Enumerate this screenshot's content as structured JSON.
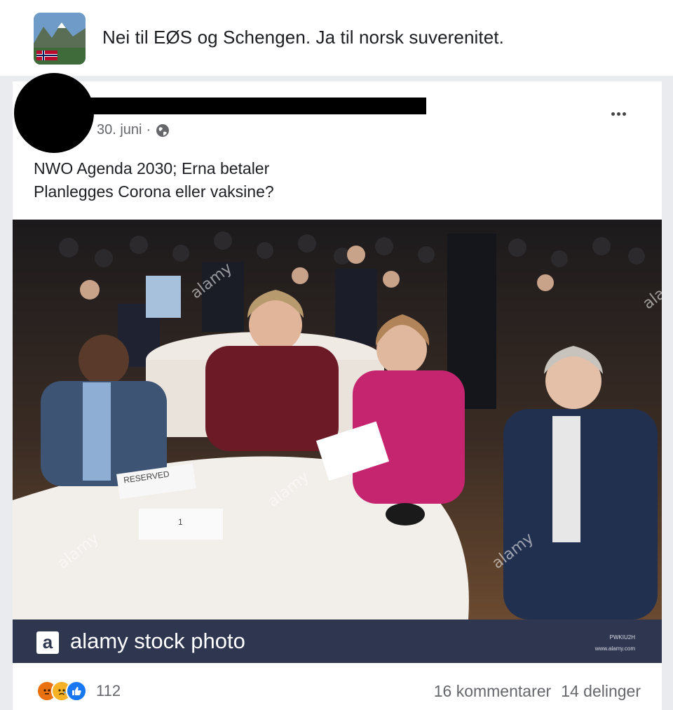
{
  "group": {
    "name": "Nei til EØS og Schengen. Ja til norsk suverenitet.",
    "avatar_icon": "landscape-flag-icon"
  },
  "post": {
    "date": "30. juni",
    "date_separator": "·",
    "privacy_icon": "globe-icon",
    "more_icon": "more-options-icon",
    "text_lines": [
      "NWO Agenda 2030; Erna betaler",
      "Planlegges Corona eller vaksine?"
    ],
    "photo": {
      "card_labels": [
        "RESERVED",
        "1"
      ],
      "watermarks": [
        "alamy",
        "a"
      ],
      "footer_logo": "a",
      "footer_text": "alamy stock photo",
      "image_id": "PWKIU2H",
      "site": "www.alamy.com"
    }
  },
  "footer": {
    "reaction_icons": [
      "angry-icon",
      "sad-icon",
      "like-icon"
    ],
    "reaction_count": "112",
    "comments": "16 kommentarer",
    "shares": "14 delinger"
  },
  "colors": {
    "brand_bar": "#2f3650",
    "like_blue": "#1877f2",
    "angry_orange": "#e9710f",
    "sad_yellow": "#f7b125"
  }
}
